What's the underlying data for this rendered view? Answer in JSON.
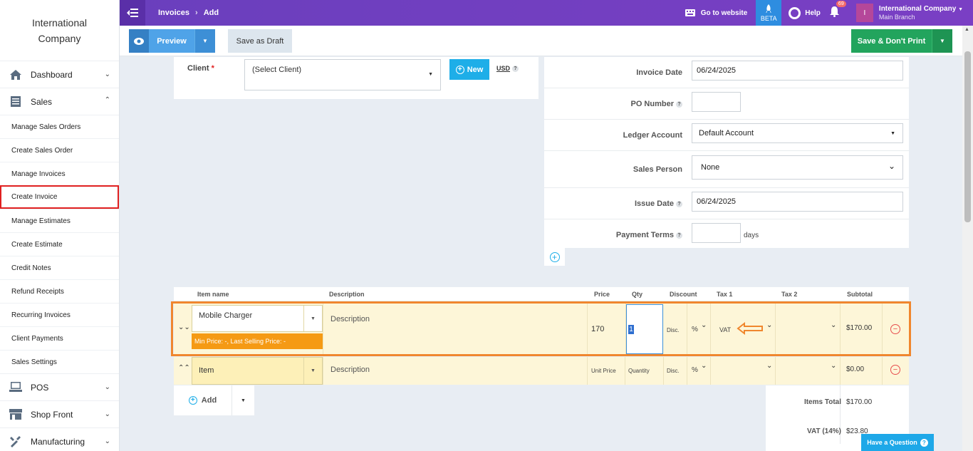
{
  "sidebar": {
    "company": "International Company",
    "main_items": [
      {
        "label": "Dashboard"
      },
      {
        "label": "Sales"
      },
      {
        "label": "POS"
      },
      {
        "label": "Shop Front"
      },
      {
        "label": "Manufacturing"
      }
    ],
    "sales_sub": [
      {
        "label": "Manage Sales Orders"
      },
      {
        "label": "Create Sales Order"
      },
      {
        "label": "Manage Invoices"
      },
      {
        "label": "Create Invoice"
      },
      {
        "label": "Manage Estimates"
      },
      {
        "label": "Create Estimate"
      },
      {
        "label": "Credit Notes"
      },
      {
        "label": "Refund Receipts"
      },
      {
        "label": "Recurring Invoices"
      },
      {
        "label": "Client Payments"
      },
      {
        "label": "Sales Settings"
      }
    ],
    "active_sub": "Create Invoice"
  },
  "topbar": {
    "breadcrumb": [
      "Invoices",
      "Add"
    ],
    "go_to_website": "Go to website",
    "beta": "BETA",
    "help": "Help",
    "notifications": "69",
    "user_initial": "I",
    "user_name": "International Company",
    "user_branch": "Main Branch"
  },
  "actions": {
    "preview": "Preview",
    "save_draft": "Save as Draft",
    "save_dont_print": "Save & Don't Print"
  },
  "client": {
    "label": "Client",
    "required_mark": "*",
    "select_value": "(Select Client)",
    "new_button": "New",
    "currency": "USD",
    "help_mark": "?"
  },
  "details": {
    "invoice_date": {
      "label": "Invoice Date",
      "value": "06/24/2025"
    },
    "po_number": {
      "label": "PO Number",
      "value": ""
    },
    "ledger_account": {
      "label": "Ledger Account",
      "value": "Default Account"
    },
    "sales_person": {
      "label": "Sales Person",
      "value": "None"
    },
    "issue_date": {
      "label": "Issue Date",
      "value": "06/24/2025"
    },
    "payment_terms": {
      "label": "Payment Terms",
      "value": "",
      "suffix": "days"
    }
  },
  "items": {
    "headers": [
      "Item name",
      "Description",
      "Price",
      "Qty",
      "Discount",
      "Tax 1",
      "Tax 2",
      "Subtotal"
    ],
    "rows": [
      {
        "item": "Mobile Charger",
        "description": "Description",
        "price": "170",
        "qty": "1",
        "disc_label": "Disc.",
        "disc_type": "%",
        "tax1": "VAT",
        "tax2": "",
        "subtotal": "$170.00",
        "hint": "Min Price: -, Last Selling Price: -"
      },
      {
        "item": "Item",
        "description": "Description",
        "price": "Unit Price",
        "qty": "Quantity",
        "disc_label": "Disc.",
        "disc_type": "%",
        "tax1": "",
        "tax2": "",
        "subtotal": "$0.00"
      }
    ],
    "add_button": "Add"
  },
  "totals": {
    "items_total_label": "Items Total",
    "items_total": "$170.00",
    "vat_label": "VAT (14%)",
    "vat": "$23.80"
  },
  "help_widget": "Have a Question"
}
